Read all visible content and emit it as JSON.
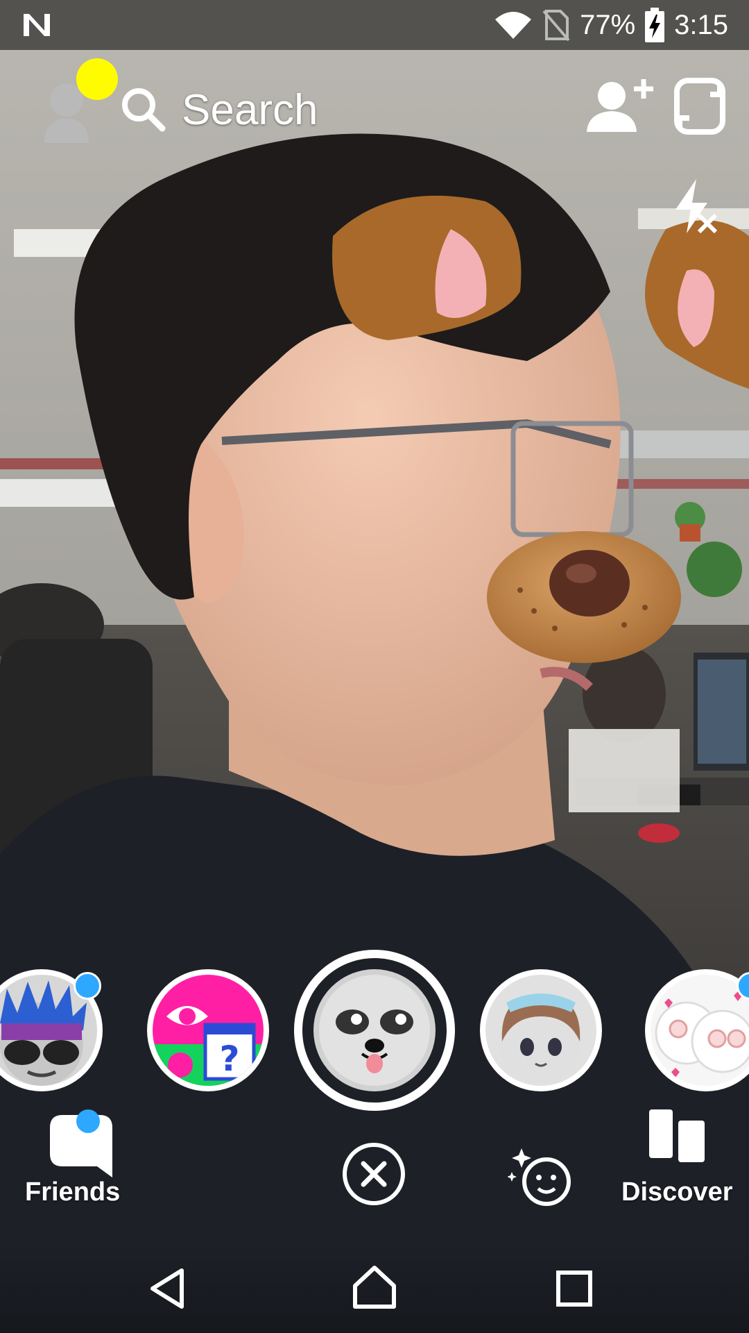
{
  "status_bar": {
    "battery_percent": "77%",
    "time": "3:15",
    "icons": [
      "n-notification-icon",
      "wifi-icon",
      "no-sim-icon",
      "battery-charging-icon"
    ]
  },
  "top_bar": {
    "search_placeholder": "Search",
    "icons": [
      "profile-avatar-icon",
      "search-icon",
      "add-friend-icon",
      "flip-camera-icon",
      "flash-off-icon"
    ]
  },
  "lenses": [
    {
      "name": "punk-hair-lens",
      "has_badge": true
    },
    {
      "name": "mystery-eye-lens",
      "has_badge": false
    },
    {
      "name": "puppy-lens",
      "selected": true
    },
    {
      "name": "anime-girl-lens",
      "has_badge": false
    },
    {
      "name": "heart-glasses-lens",
      "has_badge": true
    }
  ],
  "bottom_nav": {
    "friends_label": "Friends",
    "discover_label": "Discover",
    "icons": [
      "chat-icon",
      "close-icon",
      "lens-explorer-icon",
      "discover-icon"
    ]
  },
  "colors": {
    "snap_yellow": "#fffc00",
    "badge_blue": "#2ea8ff",
    "dog_ear_brown": "#a8692a",
    "dog_ear_pink": "#f3b1b5"
  }
}
